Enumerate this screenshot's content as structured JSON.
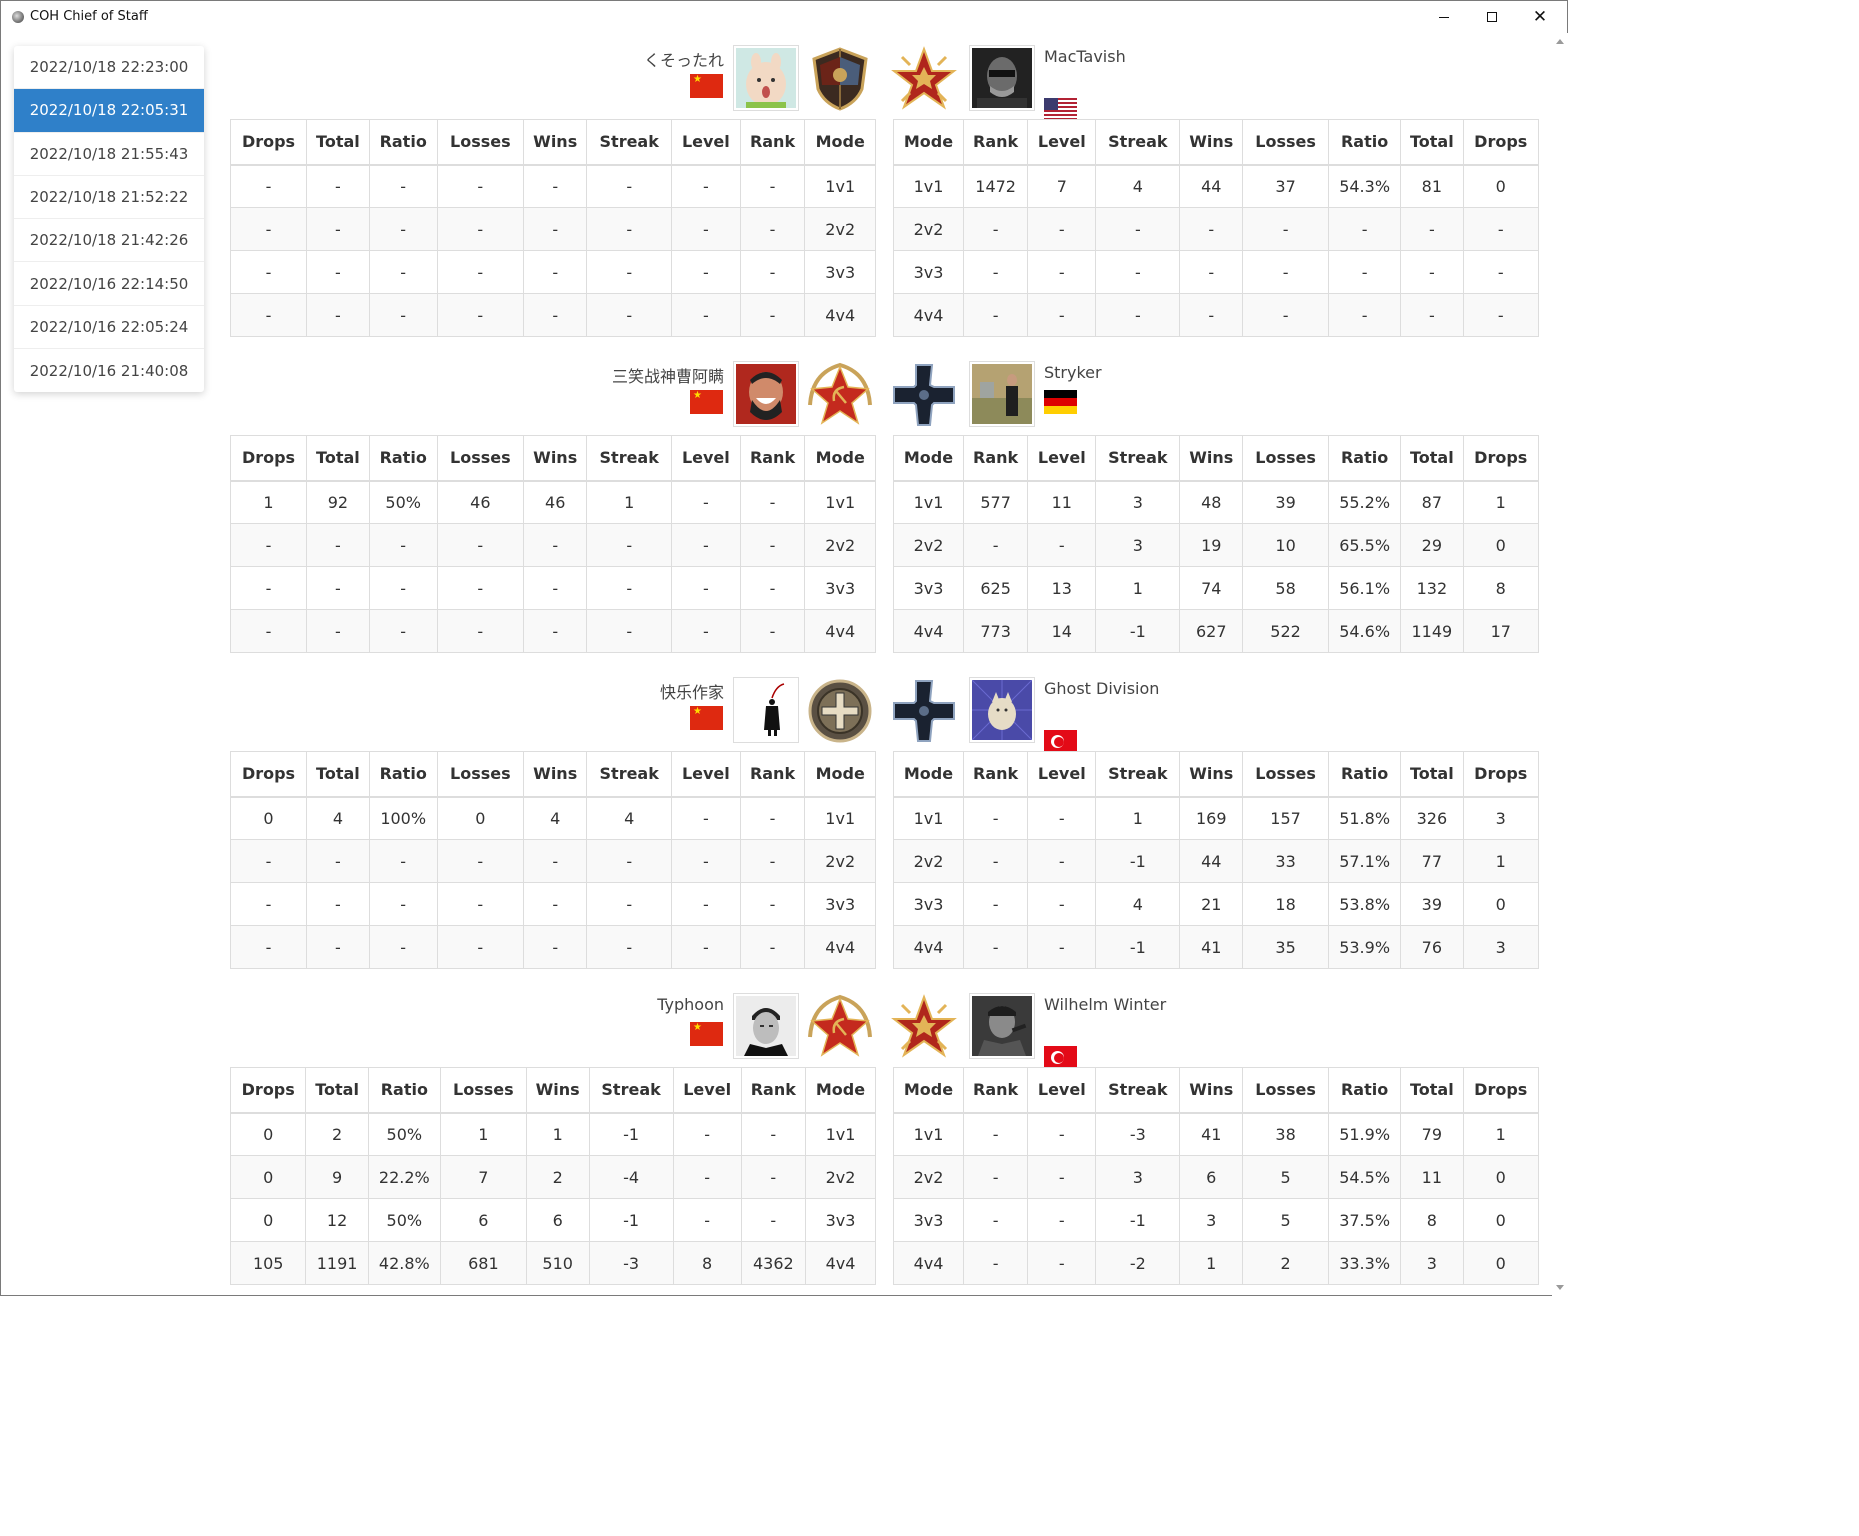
{
  "window": {
    "title": "COH Chief of Staff"
  },
  "sidebar": {
    "items": [
      {
        "label": "2022/10/18 22:23:00",
        "active": false
      },
      {
        "label": "2022/10/18 22:05:31",
        "active": true
      },
      {
        "label": "2022/10/18 21:55:43",
        "active": false
      },
      {
        "label": "2022/10/18 21:52:22",
        "active": false
      },
      {
        "label": "2022/10/18 21:42:26",
        "active": false
      },
      {
        "label": "2022/10/16 22:14:50",
        "active": false
      },
      {
        "label": "2022/10/16 22:05:24",
        "active": false
      },
      {
        "label": "2022/10/16 21:40:08",
        "active": false
      }
    ]
  },
  "headers_left": [
    "Drops",
    "Total",
    "Ratio",
    "Losses",
    "Wins",
    "Streak",
    "Level",
    "Rank",
    "Mode"
  ],
  "headers_right": [
    "Mode",
    "Rank",
    "Level",
    "Streak",
    "Wins",
    "Losses",
    "Ratio",
    "Total",
    "Drops"
  ],
  "matchups": [
    {
      "left": {
        "name": "くそったれ",
        "flag": "cn",
        "avatar": "bunny-avatar",
        "faction": "shield-emblem-icon",
        "rows": [
          [
            "-",
            "-",
            "-",
            "-",
            "-",
            "-",
            "-",
            "-",
            "1v1"
          ],
          [
            "-",
            "-",
            "-",
            "-",
            "-",
            "-",
            "-",
            "-",
            "2v2"
          ],
          [
            "-",
            "-",
            "-",
            "-",
            "-",
            "-",
            "-",
            "-",
            "3v3"
          ],
          [
            "-",
            "-",
            "-",
            "-",
            "-",
            "-",
            "-",
            "-",
            "4v4"
          ]
        ]
      },
      "right": {
        "name": "MacTavish",
        "flag": "us",
        "avatar": "masked-soldier-avatar",
        "faction": "red-star-emblem-icon",
        "rows": [
          [
            "1v1",
            "1472",
            "7",
            "4",
            "44",
            "37",
            "54.3%",
            "81",
            "0"
          ],
          [
            "2v2",
            "-",
            "-",
            "-",
            "-",
            "-",
            "-",
            "-",
            "-"
          ],
          [
            "3v3",
            "-",
            "-",
            "-",
            "-",
            "-",
            "-",
            "-",
            "-"
          ],
          [
            "4v4",
            "-",
            "-",
            "-",
            "-",
            "-",
            "-",
            "-",
            "-"
          ]
        ]
      }
    },
    {
      "left": {
        "name": "三笑战神曹阿瞒",
        "flag": "cn",
        "avatar": "laughing-man-avatar",
        "faction": "hammer-sickle-emblem-icon",
        "rows": [
          [
            "1",
            "92",
            "50%",
            "46",
            "46",
            "1",
            "-",
            "-",
            "1v1"
          ],
          [
            "-",
            "-",
            "-",
            "-",
            "-",
            "-",
            "-",
            "-",
            "2v2"
          ],
          [
            "-",
            "-",
            "-",
            "-",
            "-",
            "-",
            "-",
            "-",
            "3v3"
          ],
          [
            "-",
            "-",
            "-",
            "-",
            "-",
            "-",
            "-",
            "-",
            "4v4"
          ]
        ]
      },
      "right": {
        "name": "Stryker",
        "flag": "de",
        "avatar": "man-field-avatar",
        "faction": "iron-cross-emblem-icon",
        "rows": [
          [
            "1v1",
            "577",
            "11",
            "3",
            "48",
            "39",
            "55.2%",
            "87",
            "1"
          ],
          [
            "2v2",
            "-",
            "-",
            "3",
            "19",
            "10",
            "65.5%",
            "29",
            "0"
          ],
          [
            "3v3",
            "625",
            "13",
            "1",
            "74",
            "58",
            "56.1%",
            "132",
            "8"
          ],
          [
            "4v4",
            "773",
            "14",
            "-1",
            "627",
            "522",
            "54.6%",
            "1149",
            "17"
          ]
        ]
      }
    },
    {
      "left": {
        "name": "快乐作家",
        "flag": "cn",
        "avatar": "hanging-figure-avatar",
        "faction": "round-cross-emblem-icon",
        "rows": [
          [
            "0",
            "4",
            "100%",
            "0",
            "4",
            "4",
            "-",
            "-",
            "1v1"
          ],
          [
            "-",
            "-",
            "-",
            "-",
            "-",
            "-",
            "-",
            "-",
            "2v2"
          ],
          [
            "-",
            "-",
            "-",
            "-",
            "-",
            "-",
            "-",
            "-",
            "3v3"
          ],
          [
            "-",
            "-",
            "-",
            "-",
            "-",
            "-",
            "-",
            "-",
            "4v4"
          ]
        ]
      },
      "right": {
        "name": "Ghost Division",
        "flag": "tr",
        "avatar": "cat-avatar",
        "faction": "iron-cross-emblem-icon",
        "rows": [
          [
            "1v1",
            "-",
            "-",
            "1",
            "169",
            "157",
            "51.8%",
            "326",
            "3"
          ],
          [
            "2v2",
            "-",
            "-",
            "-1",
            "44",
            "33",
            "57.1%",
            "77",
            "1"
          ],
          [
            "3v3",
            "-",
            "-",
            "4",
            "21",
            "18",
            "53.8%",
            "39",
            "0"
          ],
          [
            "4v4",
            "-",
            "-",
            "-1",
            "41",
            "35",
            "53.9%",
            "76",
            "3"
          ]
        ]
      }
    },
    {
      "left": {
        "name": "Typhoon",
        "flag": "cn",
        "avatar": "officer-portrait-avatar",
        "faction": "hammer-sickle-emblem-icon",
        "rows": [
          [
            "0",
            "2",
            "50%",
            "1",
            "1",
            "-1",
            "-",
            "-",
            "1v1"
          ],
          [
            "0",
            "9",
            "22.2%",
            "7",
            "2",
            "-4",
            "-",
            "-",
            "2v2"
          ],
          [
            "0",
            "12",
            "50%",
            "6",
            "6",
            "-1",
            "-",
            "-",
            "3v3"
          ],
          [
            "105",
            "1191",
            "42.8%",
            "681",
            "510",
            "-3",
            "8",
            "4362",
            "4v4"
          ]
        ]
      },
      "right": {
        "name": "Wilhelm Winter",
        "flag": "tr",
        "avatar": "soldier-portrait-avatar",
        "faction": "red-star-emblem-icon",
        "rows": [
          [
            "1v1",
            "-",
            "-",
            "-3",
            "41",
            "38",
            "51.9%",
            "79",
            "1"
          ],
          [
            "2v2",
            "-",
            "-",
            "3",
            "6",
            "5",
            "54.5%",
            "11",
            "0"
          ],
          [
            "3v3",
            "-",
            "-",
            "-1",
            "3",
            "5",
            "37.5%",
            "8",
            "0"
          ],
          [
            "4v4",
            "-",
            "-",
            "-2",
            "1",
            "2",
            "33.3%",
            "3",
            "0"
          ]
        ]
      }
    }
  ]
}
